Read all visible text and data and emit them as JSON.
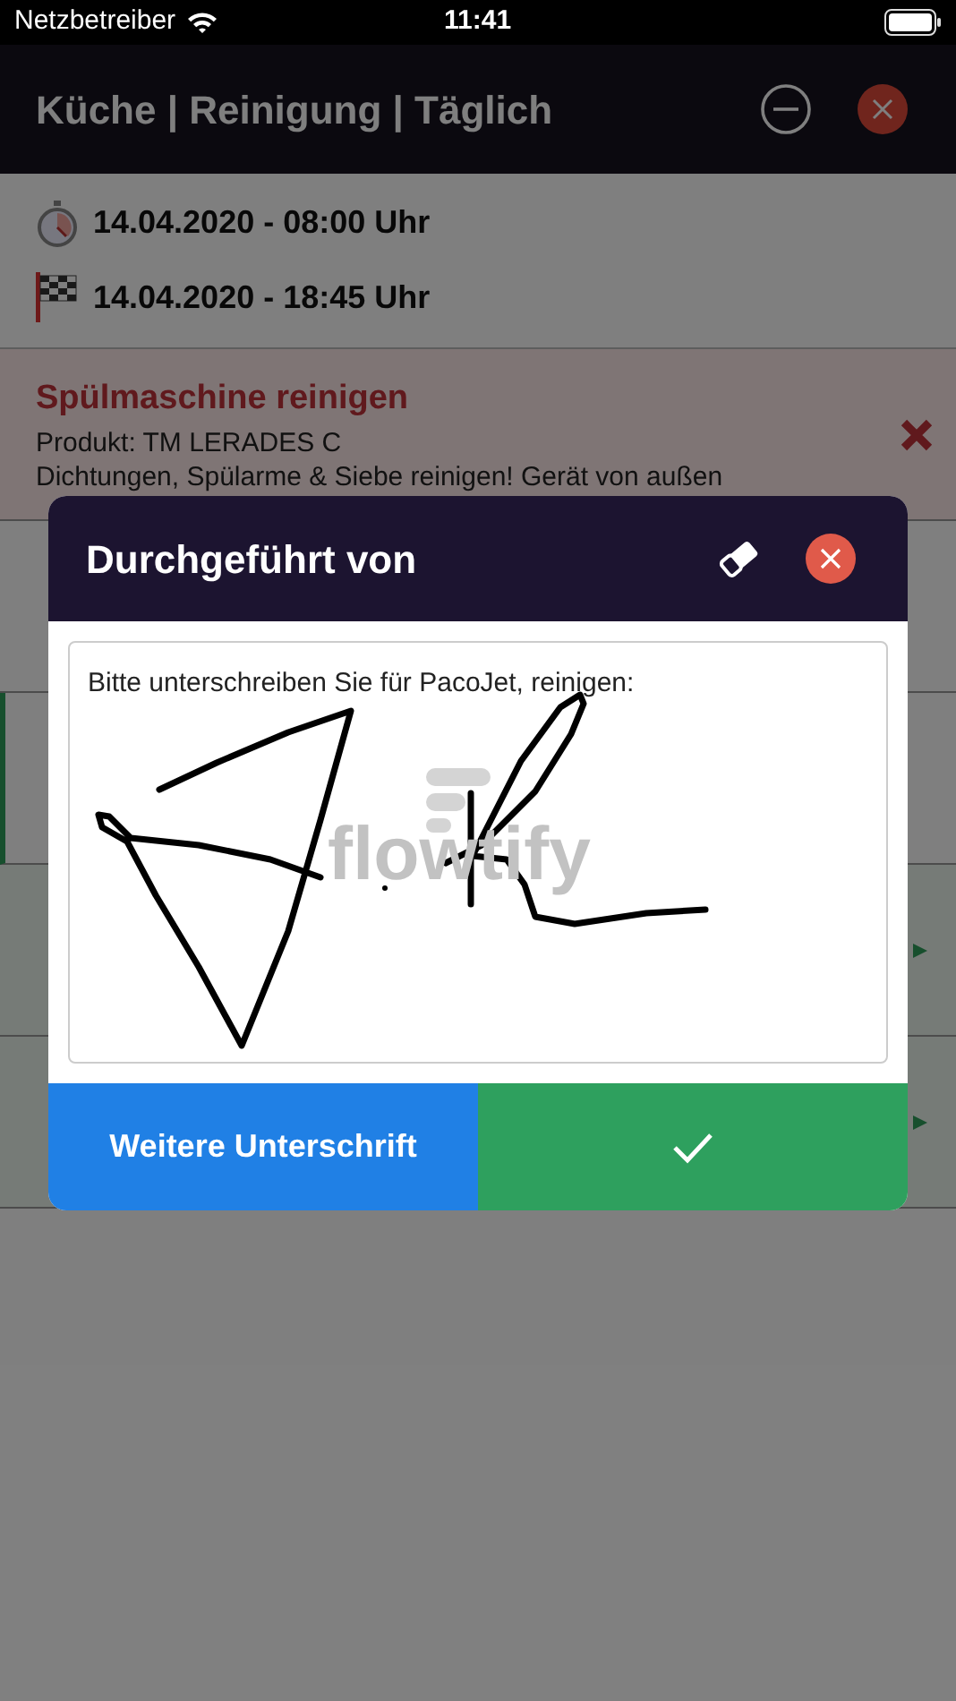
{
  "status_bar": {
    "carrier": "Netzbetreiber",
    "time": "11:41"
  },
  "header": {
    "title": "Küche | Reinigung | Täglich"
  },
  "schedule": [
    {
      "kind": "start",
      "text": "14.04.2020 - 08:00 Uhr"
    },
    {
      "kind": "end",
      "text": "14.04.2020 - 18:45 Uhr"
    }
  ],
  "tasks": [
    {
      "kind": "failed",
      "title": "Spülmaschine reinigen",
      "lines": [
        "Produkt: TM LERADES C",
        "Dichtungen, Spülarme & Siebe reinigen! Gerät von außen"
      ]
    },
    {
      "kind": "open"
    },
    {
      "kind": "active"
    },
    {
      "kind": "done"
    },
    {
      "kind": "done"
    }
  ],
  "dialog": {
    "title": "Durchgeführt von",
    "prompt": "Bitte unterschreiben Sie für PacoJet, reinigen:",
    "pad_logo": "flowtify",
    "buttons": [
      {
        "kind": "secondary",
        "label": "Weitere Unterschrift"
      },
      {
        "kind": "confirm"
      }
    ]
  }
}
